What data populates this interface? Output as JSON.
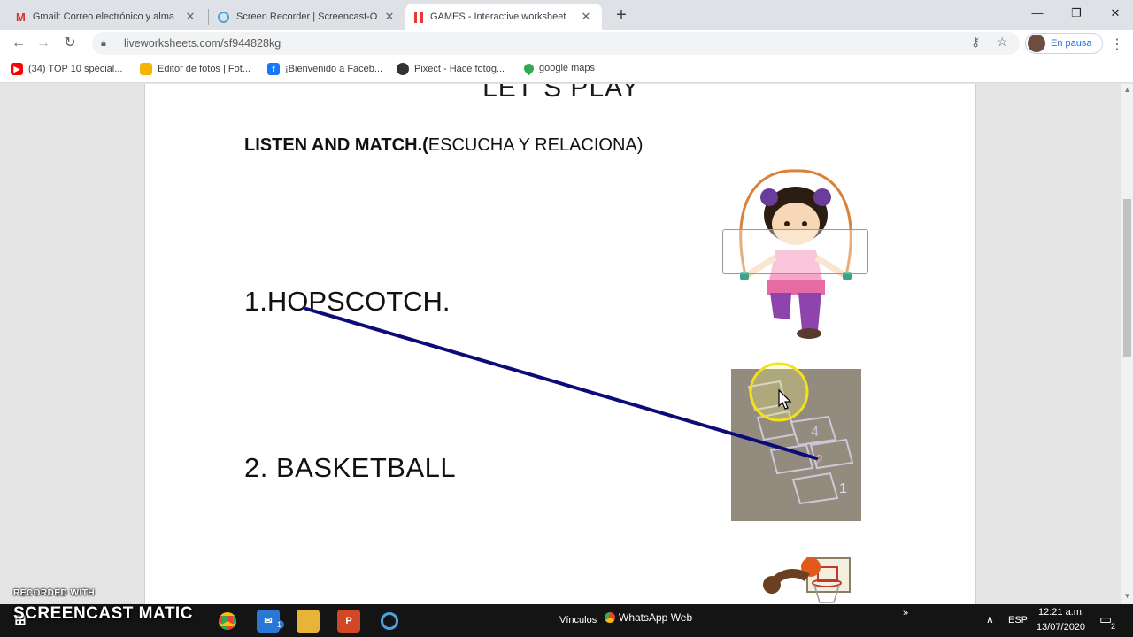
{
  "browser": {
    "tabs": [
      {
        "title": "Gmail: Correo electrónico y alma",
        "icon": "gmail-icon",
        "active": false
      },
      {
        "title": "Screen Recorder | Screencast-O-M",
        "icon": "screencast-icon",
        "active": false
      },
      {
        "title": "GAMES - Interactive worksheet",
        "icon": "liveworksheets-icon",
        "active": true
      }
    ],
    "new_tab_label": "+",
    "url": "liveworksheets.com/sf944828kg",
    "profile_label": "En pausa",
    "window_controls": {
      "minimize": "—",
      "maximize": "❐",
      "close": "✕"
    },
    "bookmarks": [
      {
        "label": "(34) TOP 10 spécial...",
        "icon": "youtube-icon",
        "color": "#ff0000"
      },
      {
        "label": "Editor de fotos | Fot...",
        "icon": "photo-editor-icon",
        "color": "#f4b400"
      },
      {
        "label": "¡Bienvenido a Faceb...",
        "icon": "facebook-icon",
        "color": "#1877f2"
      },
      {
        "label": "Pixect - Hace fotog...",
        "icon": "pixect-icon",
        "color": "#333333"
      },
      {
        "label": "google maps",
        "icon": "maps-pin-icon",
        "color": "#34a853"
      }
    ]
  },
  "worksheet": {
    "title": "LET´S PLAY",
    "instruction_bold": "LISTEN AND MATCH.(",
    "instruction_rest": "ESCUCHA Y RELACIONA)",
    "items": [
      {
        "label": "1.HOPSCOTCH."
      },
      {
        "label": "2.  BASKETBALL"
      }
    ],
    "line_color": "#0b0b7a"
  },
  "taskbar": {
    "links_label": "Vínculos",
    "whatsapp_label": "WhatsApp Web",
    "language": "ESP",
    "time": "12:21 a.m.",
    "date": "13/07/2020",
    "notification_count": "2",
    "mail_badge": "1"
  },
  "watermark": {
    "small": "RECORDED WITH",
    "big": "SCREENCAST  MATIC"
  }
}
